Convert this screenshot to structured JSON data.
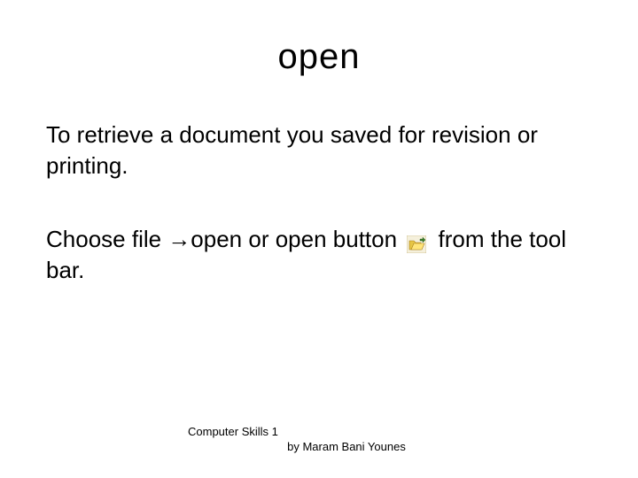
{
  "title": "open",
  "para1": "To retrieve a document you saved for revision or printing.",
  "para2_before": "Choose file →open or open button",
  "para2_after": "from the tool bar.",
  "footer_line1": "Computer Skills 1",
  "footer_line2": "          by Maram Bani Younes",
  "icon_name": "open-folder-icon"
}
